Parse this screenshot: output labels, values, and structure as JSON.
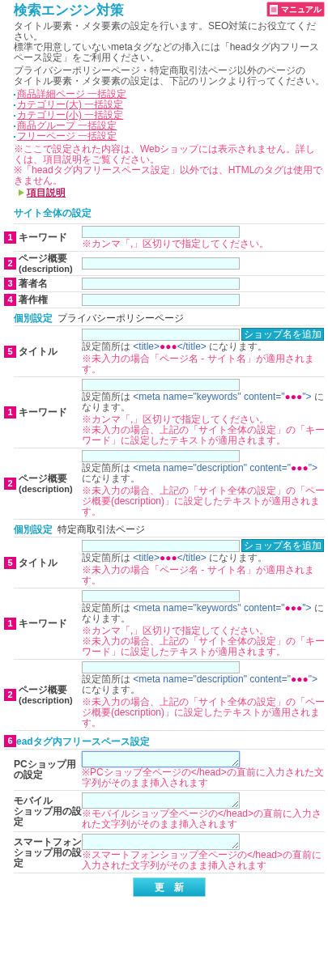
{
  "header": {
    "title": "検索エンジン対策",
    "manual_button": "マニュアル"
  },
  "intro": [
    [
      "タイトル要素・メタ要素の設定を行います。SEO対策にお役立てください。",
      "標準で用意していないmetaタグなどの挿入には「headタグ内フリースペース設定」をご利用ください。"
    ],
    [
      "プライバシーポリシーページ・特定商取引法ページ以外のページの",
      "タイトル要素・メタ要素の設定は、下記のリンクより行ってください。"
    ]
  ],
  "links": [
    "商品詳細ページ 一括設定",
    "カテゴリー(大) 一括設定",
    "カテゴリー(小) 一括設定",
    "商品グループ 一括設定",
    "フリーページ 一括設定"
  ],
  "notes": [
    "※ここで設定された内容は、Webショップには表示されません。詳しくは、項目説明をご覧ください。",
    "※「headタグ内フリースペース設定」以外では、HTMLのタグは使用できません。"
  ],
  "help_link": "項目説明",
  "sections": [
    {
      "kind": "global",
      "heading": "サイト全体の設定",
      "rows": [
        {
          "number": "1",
          "label": "キーワード",
          "notes": [
            "※カンマ「,」区切りで指定してください。"
          ]
        },
        {
          "number": "2",
          "label": "ページ概要",
          "sublabel": "(description)"
        },
        {
          "number": "3",
          "label": "著者名"
        },
        {
          "number": "4",
          "label": "著作権"
        }
      ]
    },
    {
      "kind": "individual",
      "heading": "個別設定",
      "page": "プライバシーポリシーページ",
      "rows": [
        {
          "number": "5",
          "label": "タイトル",
          "button": "ショップ名を追加",
          "hint": [
            {
              "kind": "plain",
              "text": "設定箇所は "
            },
            {
              "kind": "code",
              "text": "<title>"
            },
            {
              "kind": "dots",
              "text": "●●●"
            },
            {
              "kind": "code",
              "text": "</title>"
            },
            {
              "kind": "plain",
              "text": " になります。"
            }
          ],
          "notes": [
            "※未入力の場合「ページ名 - サイト名」が適用されます。"
          ]
        },
        {
          "number": "1",
          "label": "キーワード",
          "hint": [
            {
              "kind": "plain",
              "text": "設定箇所は "
            },
            {
              "kind": "code",
              "text": "<meta name=\"keywords\" content=\""
            },
            {
              "kind": "dots",
              "text": "●●●"
            },
            {
              "kind": "code",
              "text": "\">"
            },
            {
              "kind": "plain",
              "text": " になります。"
            }
          ],
          "notes": [
            "※カンマ「,」区切りで指定してください。",
            "※未入力の場合、上記の「サイト全体の設定」の「キーワード」に設定したテキストが適用されます。"
          ]
        },
        {
          "number": "2",
          "label": "ページ概要",
          "sublabel": "(description)",
          "hint": [
            {
              "kind": "plain",
              "text": "設定箇所は "
            },
            {
              "kind": "code",
              "text": "<meta name=\"description\" content=\""
            },
            {
              "kind": "dots",
              "text": "●●●"
            },
            {
              "kind": "code",
              "text": "\">"
            },
            {
              "kind": "plain",
              "text": " になります。"
            }
          ],
          "notes": [
            "※未入力の場合、上記の「サイト全体の設定」の「ページ概要(description)」に設定したテキストが適用されます。"
          ]
        }
      ]
    },
    {
      "kind": "individual",
      "heading": "個別設定",
      "page": "特定商取引法ページ",
      "rows": [
        {
          "number": "5",
          "label": "タイトル",
          "button": "ショップ名を追加",
          "hint": [
            {
              "kind": "plain",
              "text": "設定箇所は "
            },
            {
              "kind": "code",
              "text": "<title>"
            },
            {
              "kind": "dots",
              "text": "●●●"
            },
            {
              "kind": "code",
              "text": "</title>"
            },
            {
              "kind": "plain",
              "text": " になります。"
            }
          ],
          "notes": [
            "※未入力の場合「ページ名 - サイト名」が適用されます。"
          ]
        },
        {
          "number": "1",
          "label": "キーワード",
          "hint": [
            {
              "kind": "plain",
              "text": "設定箇所は "
            },
            {
              "kind": "code",
              "text": "<meta name=\"keywords\" content=\""
            },
            {
              "kind": "dots",
              "text": "●●●"
            },
            {
              "kind": "code",
              "text": "\">"
            },
            {
              "kind": "plain",
              "text": " になります。"
            }
          ],
          "notes": [
            "※カンマ「,」区切りで指定してください。",
            "※未入力の場合、上記の「サイト全体の設定」の「キーワード」に設定したテキストが適用されます。"
          ]
        },
        {
          "number": "2",
          "label": "ページ概要",
          "sublabel": "(description)",
          "hint": [
            {
              "kind": "plain",
              "text": "設定箇所は "
            },
            {
              "kind": "code",
              "text": "<meta name=\"description\" content=\""
            },
            {
              "kind": "dots",
              "text": "●●●"
            },
            {
              "kind": "code",
              "text": "\">"
            },
            {
              "kind": "plain",
              "text": " になります。"
            }
          ],
          "notes": [
            "※未入力の場合、上記の「サイト全体の設定」の「ページ概要(description)」に設定したテキストが適用されます。"
          ]
        }
      ]
    }
  ],
  "free_space": {
    "number": "6",
    "heading": "eadタグ内フリースペース設定",
    "rows": [
      {
        "label_lines": [
          "PCショップ用の設定"
        ],
        "focused": true,
        "note": "※PCショップ全ページの</head>の直前に入力された文字列がそのまま挿入されます"
      },
      {
        "label_lines": [
          "モバイル",
          "ショップ用の設定"
        ],
        "focused": false,
        "note": "※モバイルショップ全ページの</head>の直前に入力された文字列がそのまま挿入されます"
      },
      {
        "label_lines": [
          "スマートフォン",
          "ショップ用の設定"
        ],
        "focused": false,
        "note": "※スマートフォンショップ全ページの</head>の直前に入力された文字列がそのまま挿入されます"
      }
    ]
  },
  "submit": "更　新"
}
